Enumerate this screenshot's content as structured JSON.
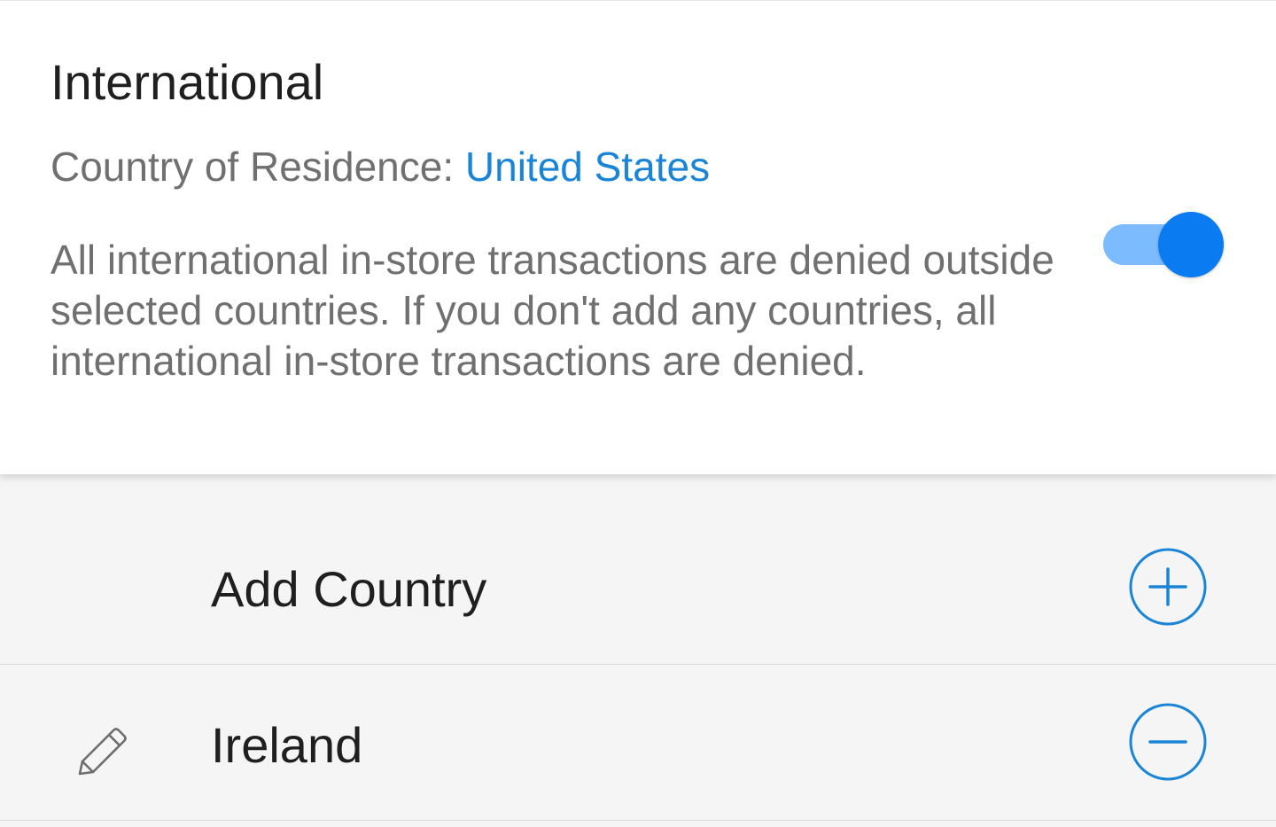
{
  "section": {
    "title": "International",
    "residence_label": "Country of Residence: ",
    "residence_value": "United States",
    "description": "All international in-store transactions are denied outside selected countries. If you don't add any countries, all international in-store transactions are denied.",
    "toggle_on": true
  },
  "add_row": {
    "label": "Add Country",
    "icon": "plus-circle-icon"
  },
  "countries": [
    {
      "label": "Ireland",
      "edit_icon": "pencil-icon",
      "remove_icon": "minus-circle-icon"
    }
  ],
  "colors": {
    "accent": "#1a85d6",
    "toggle_knob": "#0a7bf0",
    "toggle_track": "#7dbbff",
    "text_primary": "#1f1f1f",
    "text_secondary": "#707070",
    "background": "#f5f5f5"
  }
}
